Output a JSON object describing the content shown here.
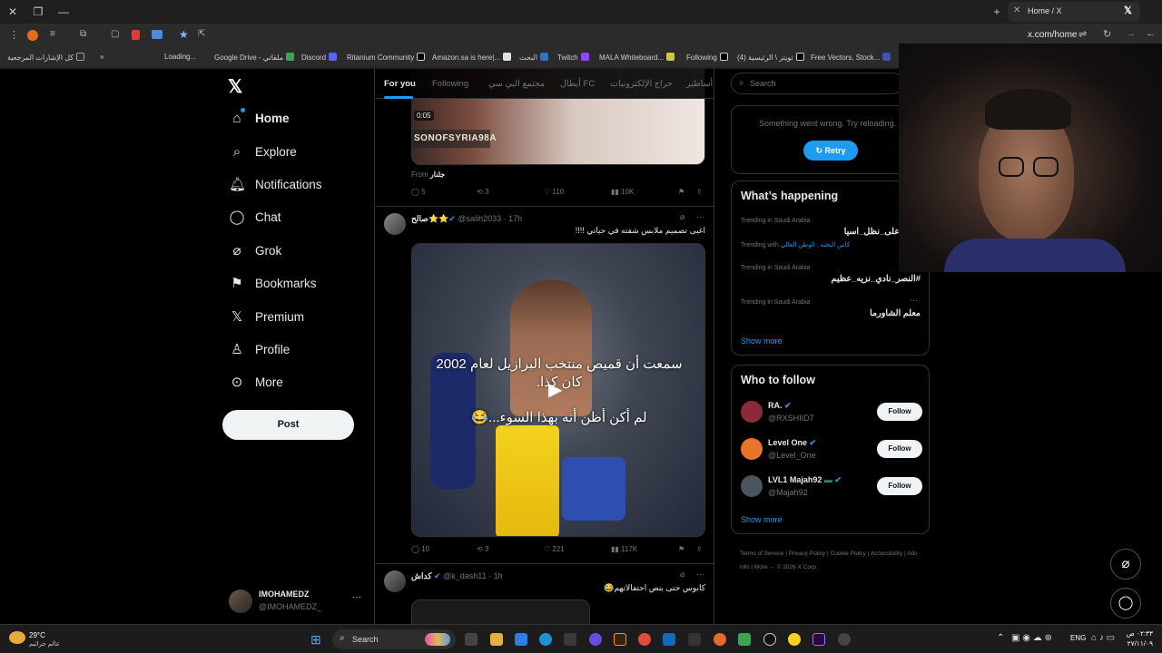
{
  "browser": {
    "tab_title": "Home / X",
    "address": "x.com/home",
    "bookmarks": [
      {
        "label": "كل الإشارات المرجعية",
        "color": "#9aa0a6"
      },
      {
        "label": "Loading...",
        "color": "#888888"
      },
      {
        "label": "Google Drive - ملفاتي",
        "color": "#34a853"
      },
      {
        "label": "Discord",
        "color": "#5865f2"
      },
      {
        "label": "Ritanium Community",
        "color": "#e0e0e0"
      },
      {
        "label": "Amazon.sa is here|...",
        "color": "#e0e0e0"
      },
      {
        "label": "البحث",
        "color": "#2f6fd6"
      },
      {
        "label": "Twitch",
        "color": "#9146ff"
      },
      {
        "label": "MALA Whiteboard...",
        "color": "#d4c34a"
      },
      {
        "label": "Following",
        "color": "#e0e0e0"
      },
      {
        "label": "تويتر \\ الرئيسية (4)",
        "color": "#e0e0e0"
      },
      {
        "label": "Free Vectors, Stock...",
        "color": "#3f51b5"
      }
    ]
  },
  "nav": {
    "items": [
      {
        "label": "Home",
        "icon": "home-icon"
      },
      {
        "label": "Explore",
        "icon": "search-icon"
      },
      {
        "label": "Notifications",
        "icon": "bell-icon"
      },
      {
        "label": "Chat",
        "icon": "chat-icon"
      },
      {
        "label": "Grok",
        "icon": "grok-icon"
      },
      {
        "label": "Bookmarks",
        "icon": "bookmark-icon"
      },
      {
        "label": "Premium",
        "icon": "x-icon"
      },
      {
        "label": "Profile",
        "icon": "person-icon"
      },
      {
        "label": "More",
        "icon": "more-icon"
      }
    ],
    "post_label": "Post",
    "account_name": "IMOHAMEDZ",
    "account_handle": "@IMOHAMEDZ_"
  },
  "timeline": {
    "tabs": [
      "For you",
      "Following",
      "مجتمع البي سي",
      "أبطال FC",
      "حراج الإلكترونيات",
      "أساطير"
    ],
    "tweet0": {
      "video_text": "SONOFSYRIA98A",
      "time_badge": "0:05",
      "from_label": "From",
      "from_name": "جلنار",
      "replies": "5",
      "reposts": "3",
      "likes": "110",
      "views": "10K"
    },
    "tweet1": {
      "name": "صالح",
      "handle": "@salih2033",
      "time": "17h",
      "text": "اغبى تصميم ملابس شفته في حياتي !!!!",
      "overlay1": "سمعت أن قميص منتخب البرازيل لعام 2002",
      "overlay2": "كان كذا.",
      "overlay3": "لم أكن أظن أنه بهذا السوء...😂",
      "replies": "10",
      "reposts": "3",
      "likes": "221",
      "views": "117K"
    },
    "tweet2": {
      "name": "كداش",
      "handle": "@k_dash11",
      "time": "1h",
      "text": "كابوس حتى بنص احتفالاتهم😂"
    }
  },
  "sidebar": {
    "search_placeholder": "Search",
    "error_text": "Something went wrong. Try reloading.",
    "retry_label": "Retry",
    "whats_happening_title": "What’s happening",
    "trends": [
      {
        "context": "Trending in Saudi Arabia",
        "title": "على_نظل_اسيا",
        "extra": ""
      },
      {
        "context": "Trending with",
        "title": "",
        "extra": "كاس النخبه , الوطن الغالي"
      },
      {
        "context": "Trending in Saudi Arabia",
        "title": "#النصر_نادي_نزيه_عظيم",
        "extra": ""
      },
      {
        "context": "Trending in Saudi Arabia",
        "title": "معلم الشاورما",
        "extra": ""
      }
    ],
    "show_more": "Show more",
    "who_to_follow_title": "Who to follow",
    "follow_suggestions": [
      {
        "name": "RA.",
        "handle": "@RXSHIID7",
        "avatar_color": "#8b2a3b"
      },
      {
        "name": "Level One",
        "handle": "@Level_One",
        "avatar_color": "#e8742a"
      },
      {
        "name": "LVL1 Majah92",
        "handle": "@Majah92",
        "avatar_color": "#4a5560"
      }
    ],
    "follow_label": "Follow",
    "footer": [
      "Terms of Service",
      "Privacy Policy",
      "Cookie Policy",
      "Accessibility",
      "Ads info",
      "More ···",
      "© 2026 X Corp."
    ]
  },
  "taskbar": {
    "weather_temp": "29°C",
    "weather_text": "عالم جراثيم",
    "search_label": "Search",
    "lang": "ENG",
    "time": "٠٢:٣٣ ص",
    "date": "٢٧/١١/٠٩"
  }
}
